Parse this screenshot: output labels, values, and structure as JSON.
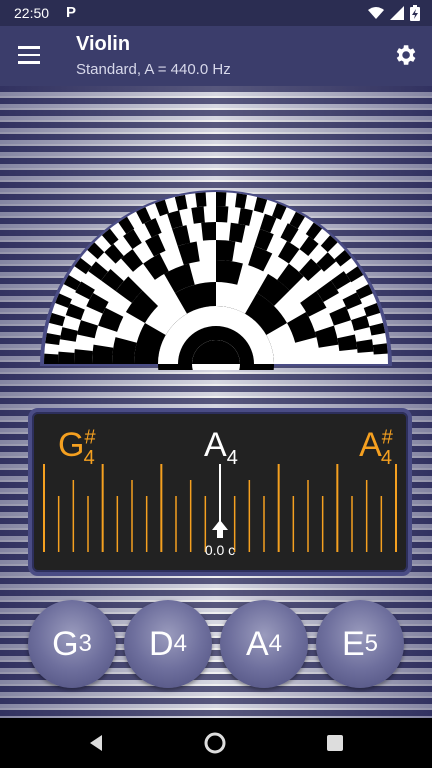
{
  "status_bar": {
    "time": "22:50",
    "app_indicator": "P",
    "icons": [
      "wifi-icon",
      "signal-icon",
      "battery-charging-icon"
    ]
  },
  "app_bar": {
    "title": "Violin",
    "subtitle": "Standard, A = 440.0 Hz",
    "menu_icon": "hamburger-menu-icon",
    "settings_icon": "gear-icon"
  },
  "tuner": {
    "prev_note": {
      "letter": "G",
      "accidental": "#",
      "octave": "4"
    },
    "current_note": {
      "letter": "A",
      "octave": "4"
    },
    "next_note": {
      "letter": "A",
      "accidental": "#",
      "octave": "4"
    },
    "cents_offset": "0.0 c",
    "accent_color": "#f5a020"
  },
  "strings": [
    {
      "letter": "G",
      "octave": "3"
    },
    {
      "letter": "D",
      "octave": "4"
    },
    {
      "letter": "A",
      "octave": "4"
    },
    {
      "letter": "E",
      "octave": "5"
    }
  ],
  "nav_bar": {
    "back_icon": "back-triangle-icon",
    "home_icon": "home-circle-icon",
    "recents_icon": "recents-square-icon"
  }
}
